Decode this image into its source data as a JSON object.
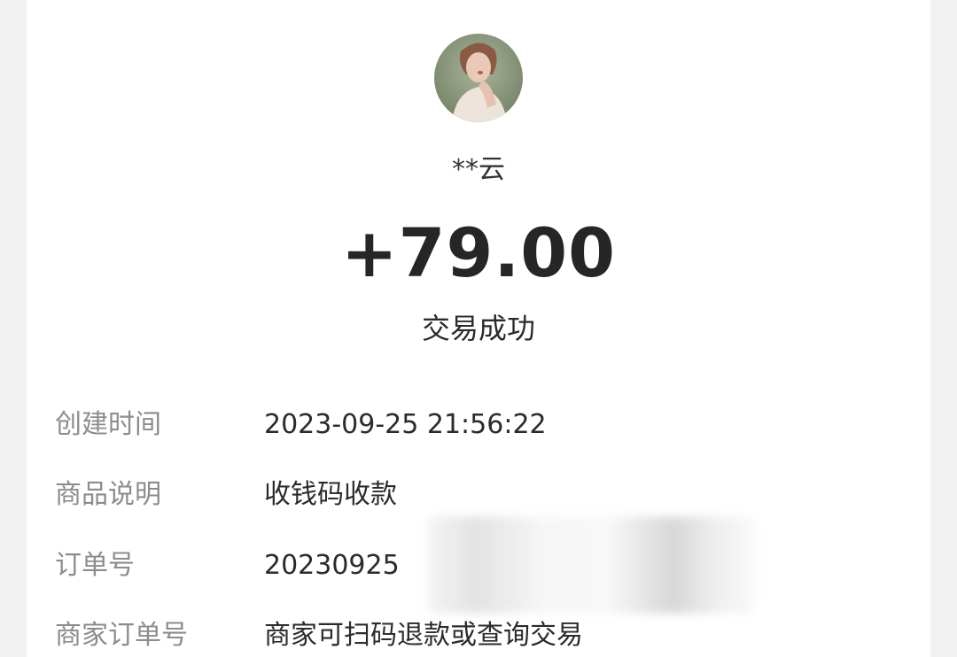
{
  "payer": {
    "name": "**云",
    "avatar": "avatar-photo"
  },
  "transaction": {
    "amount": "+79.00",
    "status": "交易成功"
  },
  "details": [
    {
      "label": "创建时间",
      "value": "2023-09-25 21:56:22"
    },
    {
      "label": "商品说明",
      "value": "收钱码收款"
    },
    {
      "label": "订单号",
      "value": "20230925"
    },
    {
      "label": "商家订单号",
      "value": "商家可扫码退款或查询交易"
    }
  ],
  "colors": {
    "page_background": "#f2f2f2",
    "card_background": "#ffffff",
    "label_text": "#8c8c8c",
    "value_text": "#2b2b2b"
  }
}
